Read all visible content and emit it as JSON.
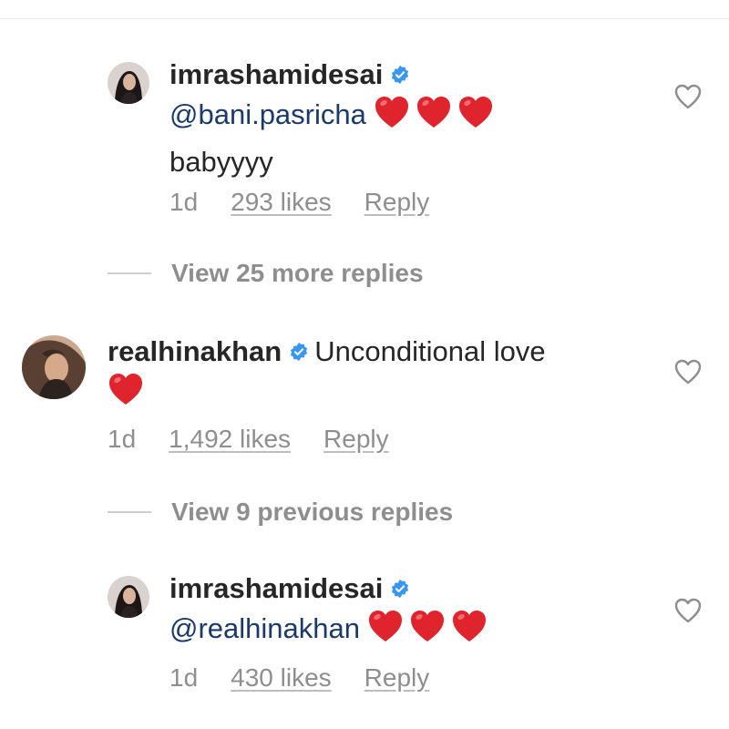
{
  "comments": [
    {
      "username": "imrashamidesai",
      "verified": true,
      "mention": "@bani.pasricha",
      "hearts": 3,
      "text": "babyyyy",
      "age": "1d",
      "likes": "293 likes",
      "reply": "Reply"
    },
    {
      "username": "realhinakhan",
      "verified": true,
      "text": "Unconditional love",
      "hearts": 1,
      "age": "1d",
      "likes": "1,492 likes",
      "reply": "Reply"
    },
    {
      "username": "imrashamidesai",
      "verified": true,
      "mention": "@realhinakhan",
      "hearts": 3,
      "age": "1d",
      "likes": "430 likes",
      "reply": "Reply"
    }
  ],
  "view_more_replies": "View 25 more replies",
  "view_previous_replies": "View 9 previous replies",
  "icons": {
    "verified": "verified-badge-icon",
    "heart_emoji": "red-heart-emoji-icon",
    "like": "heart-outline-icon"
  },
  "colors": {
    "verified_blue": "#3897f0",
    "heart_red": "#e0242d",
    "mention_blue": "#1b3a6b",
    "muted_gray": "#8e8e8e"
  }
}
